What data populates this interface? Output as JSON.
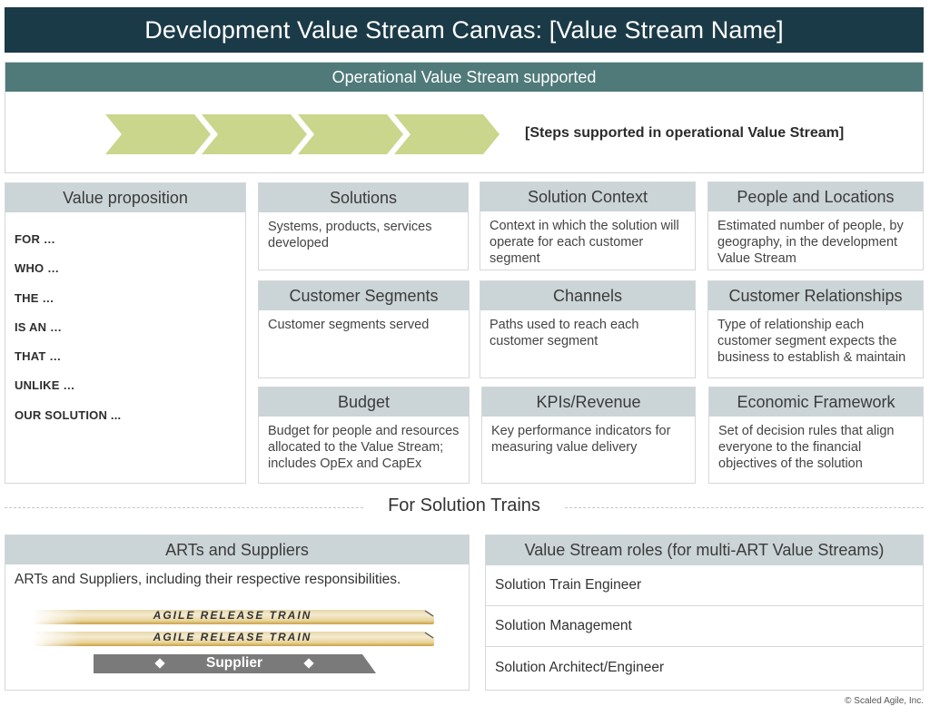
{
  "title": "Development Value Stream Canvas: [Value Stream Name]",
  "operational": {
    "header": "Operational Value Stream supported",
    "steps_label": "[Steps supported in operational Value Stream]",
    "step_count": 4,
    "chevron_color": "#c9d68c"
  },
  "value_proposition": {
    "header": "Value proposition",
    "items": [
      "FOR …",
      "WHO …",
      "THE …",
      "IS AN …",
      "THAT …",
      "UNLIKE …",
      "OUR SOLUTION ..."
    ]
  },
  "cards": {
    "solutions": {
      "header": "Solutions",
      "body": "Systems, products, services developed"
    },
    "solution_context": {
      "header": "Solution Context",
      "body": "Context in which the solution will operate for each customer segment"
    },
    "people_locations": {
      "header": "People and Locations",
      "body": "Estimated number of people, by geography, in the development Value Stream"
    },
    "customer_segments": {
      "header": "Customer Segments",
      "body": "Customer segments served"
    },
    "channels": {
      "header": "Channels",
      "body": "Paths used to reach each customer segment"
    },
    "customer_relationships": {
      "header": "Customer Relationships",
      "body": "Type of relationship each customer segment expects the business to establish & maintain"
    },
    "budget": {
      "header": "Budget",
      "body": "Budget for people and resources allocated to the Value Stream; includes OpEx and CapEx"
    },
    "kpis": {
      "header": "KPIs/Revenue",
      "body": "Key performance indicators for measuring value delivery"
    },
    "economic_framework": {
      "header": "Economic Framework",
      "body": "Set of decision rules that align everyone to the financial objectives of the solution"
    }
  },
  "solution_trains": {
    "label": "For Solution Trains",
    "arts": {
      "header": "ARTs and Suppliers",
      "description": "ARTs and Suppliers, including their respective responsibilities.",
      "trains": [
        "AGILE RELEASE TRAIN",
        "AGILE RELEASE TRAIN"
      ],
      "supplier": "Supplier"
    },
    "roles": {
      "header": "Value Stream roles (for multi-ART Value Streams)",
      "items": [
        "Solution Train Engineer",
        "Solution Management",
        "Solution Architect/Engineer"
      ]
    }
  },
  "copyright": "© Scaled Agile, Inc.",
  "colors": {
    "title_bg": "#1b3a47",
    "ops_header_bg": "#4f7a79",
    "card_header_bg": "#cbd4d7",
    "train_gold": "#d4b25e",
    "supplier_gray": "#7a7a7a"
  }
}
